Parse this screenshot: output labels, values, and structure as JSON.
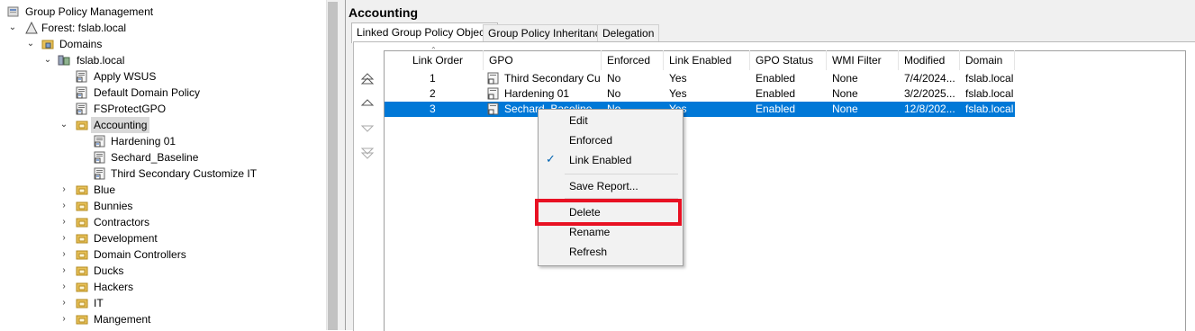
{
  "tree": {
    "root": "Group Policy Management",
    "forest": "Forest: fslab.local",
    "domains": "Domains",
    "domain": "fslab.local",
    "items": [
      {
        "label": "Apply WSUS",
        "kind": "gpo"
      },
      {
        "label": "Default Domain Policy",
        "kind": "gpo"
      },
      {
        "label": "FSProtectGPO",
        "kind": "gpo"
      },
      {
        "label": "Accounting",
        "kind": "ou",
        "expanded": true,
        "selected": true
      },
      {
        "label": "Hardening 01",
        "kind": "gpo",
        "child": true
      },
      {
        "label": "Sechard_Baseline",
        "kind": "gpo",
        "child": true
      },
      {
        "label": "Third Secondary Customize IT",
        "kind": "gpo",
        "child": true
      },
      {
        "label": "Blue",
        "kind": "ou"
      },
      {
        "label": "Bunnies",
        "kind": "ou"
      },
      {
        "label": "Contractors",
        "kind": "ou"
      },
      {
        "label": "Development",
        "kind": "ou"
      },
      {
        "label": "Domain Controllers",
        "kind": "ou"
      },
      {
        "label": "Ducks",
        "kind": "ou"
      },
      {
        "label": "Hackers",
        "kind": "ou"
      },
      {
        "label": "IT",
        "kind": "ou"
      },
      {
        "label": "Mangement",
        "kind": "ou"
      }
    ]
  },
  "pane": {
    "title": "Accounting",
    "tabs": [
      "Linked Group Policy Objects",
      "Group Policy Inheritance",
      "Delegation"
    ],
    "active_tab": 0
  },
  "table": {
    "columns": [
      "Link Order",
      "GPO",
      "Enforced",
      "Link Enabled",
      "GPO Status",
      "WMI Filter",
      "Modified",
      "Domain"
    ],
    "rows": [
      [
        "1",
        "Third Secondary Cu...",
        "No",
        "Yes",
        "Enabled",
        "None",
        "7/4/2024...",
        "fslab.local"
      ],
      [
        "2",
        "Hardening 01",
        "No",
        "Yes",
        "Enabled",
        "None",
        "3/2/2025...",
        "fslab.local"
      ],
      [
        "3",
        "Sechard_Baseline",
        "No",
        "Yes",
        "Enabled",
        "None",
        "12/8/202...",
        "fslab.local"
      ]
    ],
    "selected_row": 2
  },
  "context_menu": {
    "items": [
      {
        "label": "Edit"
      },
      {
        "label": "Enforced"
      },
      {
        "label": "Link Enabled",
        "checked": true
      },
      {
        "label": "Save Report..."
      },
      {
        "label": "Delete",
        "highlighted": true
      },
      {
        "label": "Rename"
      },
      {
        "label": "Refresh"
      }
    ]
  },
  "colors": {
    "selection": "#0078d7",
    "highlight_box": "#e81123",
    "ou_folder": "#e8c15a"
  }
}
